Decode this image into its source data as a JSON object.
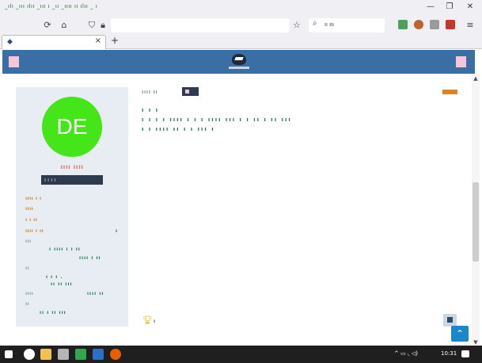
{
  "browser": {
    "menu_text": "_ılı _ııı ılıı _ııı ı _ıı _ıııı ıı ılıı _ ı",
    "search_placeholder": "ıı ııı",
    "tab_title": "",
    "new_tab": "+",
    "tab_close": "×",
    "win_minimize": "—",
    "win_restore": "❐",
    "win_close": "✕"
  },
  "profile": {
    "initials": "DE",
    "name": "ıııı ıııı",
    "badge_text": "ı ı ı ı",
    "avatar_color": "#44e61a",
    "fields": [
      {
        "label": "ıııı ı ı",
        "value": ""
      },
      {
        "label": "ıııı",
        "value": ""
      },
      {
        "label": "ı ı ıı",
        "value": ""
      },
      {
        "label": "ıııı ı ıı",
        "value": "ı"
      },
      {
        "label": "ııı",
        "value": "ı ıııı ı ı   ıı"
      },
      {
        "label": "",
        "value": "ıııı ı  ıı"
      },
      {
        "label": "ıı",
        "value": ""
      },
      {
        "label": "",
        "value": "ı ı ı ."
      },
      {
        "label": "",
        "value": "ıı ıı ııı"
      },
      {
        "label": "ıııı",
        "value": "ıııı ıı"
      },
      {
        "label": "ıı",
        "value": ""
      },
      {
        "label": "",
        "value": "ıı ı ıı ııı"
      }
    ]
  },
  "main": {
    "crumb": "ıııı ıı",
    "lines": [
      "ı  ı   ı",
      "ı ı ı ı ıııı ı  ı ı ıııı ııı  ı ı        ıı  ı  ıı  ııı",
      "ı  ı ıııı ıı  ı  ı  ııı ı"
    ],
    "trophy_value": "ı"
  },
  "taskbar": {
    "time": "10:31",
    "tray": "^ ▭ ◟ ◁)"
  },
  "colors": {
    "header": "#3a6ea5",
    "accent_orange": "#dd8422",
    "accent_green": "#1f7a4b",
    "badge_dark": "#2e3a4e",
    "pink": "#f4c6d7"
  }
}
